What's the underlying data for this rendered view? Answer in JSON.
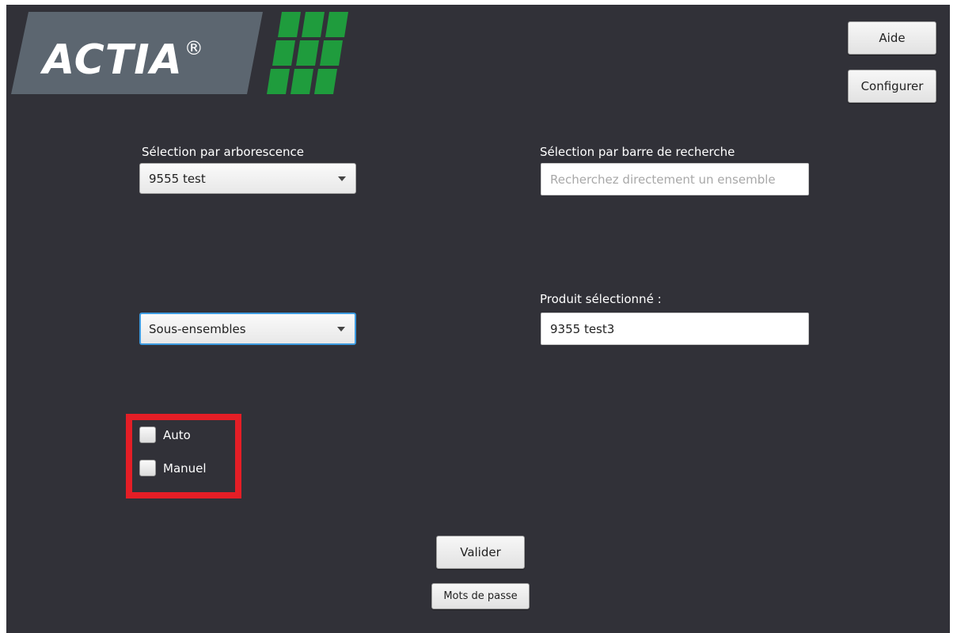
{
  "header": {
    "logo_text": "ACTIA",
    "logo_mark": "®",
    "brand_green": "#1f9c3d",
    "brand_slate": "#5c6670"
  },
  "toolbar": {
    "aide_label": "Aide",
    "configurer_label": "Configurer"
  },
  "tree_selection": {
    "label": "Sélection par arborescence",
    "selected": "9555 test"
  },
  "search_selection": {
    "label": "Sélection par barre de recherche",
    "placeholder": "Recherchez directement un ensemble",
    "value": ""
  },
  "sub_assembly": {
    "selected": "Sous-ensembles"
  },
  "selected_product": {
    "label": "Produit sélectionné :",
    "value": "9355 test3"
  },
  "mode_options": [
    {
      "label": "Auto",
      "checked": false
    },
    {
      "label": "Manuel",
      "checked": false
    }
  ],
  "highlight_color": "#e41e26",
  "actions": {
    "valider_label": "Valider",
    "mots_de_passe_label": "Mots de passe"
  }
}
